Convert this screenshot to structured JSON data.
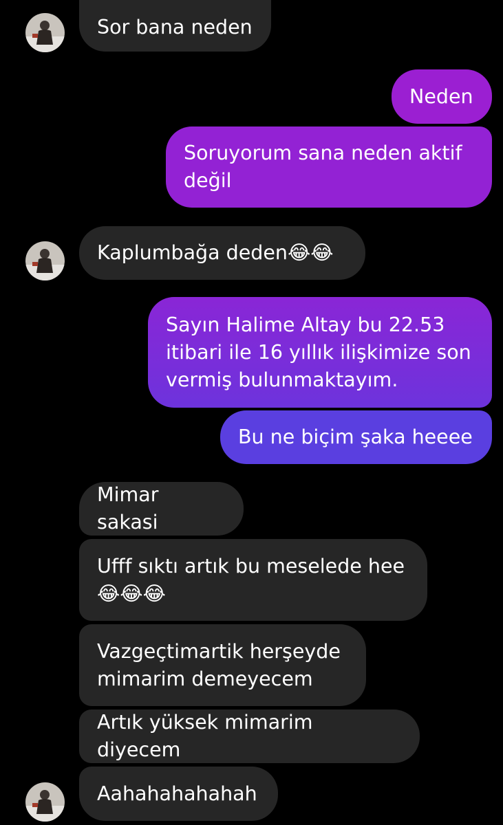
{
  "colors": {
    "background": "#000000",
    "incoming_bubble": "#262626",
    "outgoing_gradient_top": "#9a1fd2",
    "outgoing_gradient_bottom": "#5a3fe0"
  },
  "messages": [
    {
      "id": "m1",
      "side": "incoming",
      "text": "Sor bana neden"
    },
    {
      "id": "m2",
      "side": "outgoing",
      "text": "Neden"
    },
    {
      "id": "m3",
      "side": "outgoing",
      "text": "Soruyorum sana neden aktif değil"
    },
    {
      "id": "m4",
      "side": "incoming",
      "text": "Kaplumbağa deden😂😂"
    },
    {
      "id": "m5",
      "side": "outgoing",
      "text": "Sayın Halime Altay bu 22.53 itibari ile 16 yıllık ilişkimize son vermiş bulunmaktayım."
    },
    {
      "id": "m6",
      "side": "outgoing",
      "text": "Bu ne biçim şaka heeee"
    },
    {
      "id": "m7",
      "side": "incoming",
      "text": "Mimar sakasi"
    },
    {
      "id": "m8",
      "side": "incoming",
      "text": "Ufff sıktı artık bu meselede hee 😂😂😂"
    },
    {
      "id": "m9",
      "side": "incoming",
      "text": "Vazgeçtimartik herşeyde mimarim demeyecem"
    },
    {
      "id": "m10",
      "side": "incoming",
      "text": "Artık yüksek mimarim diyecem"
    },
    {
      "id": "m11",
      "side": "incoming",
      "text": "Aahahahahahah"
    }
  ],
  "avatar_icon": "contact-avatar-icon"
}
